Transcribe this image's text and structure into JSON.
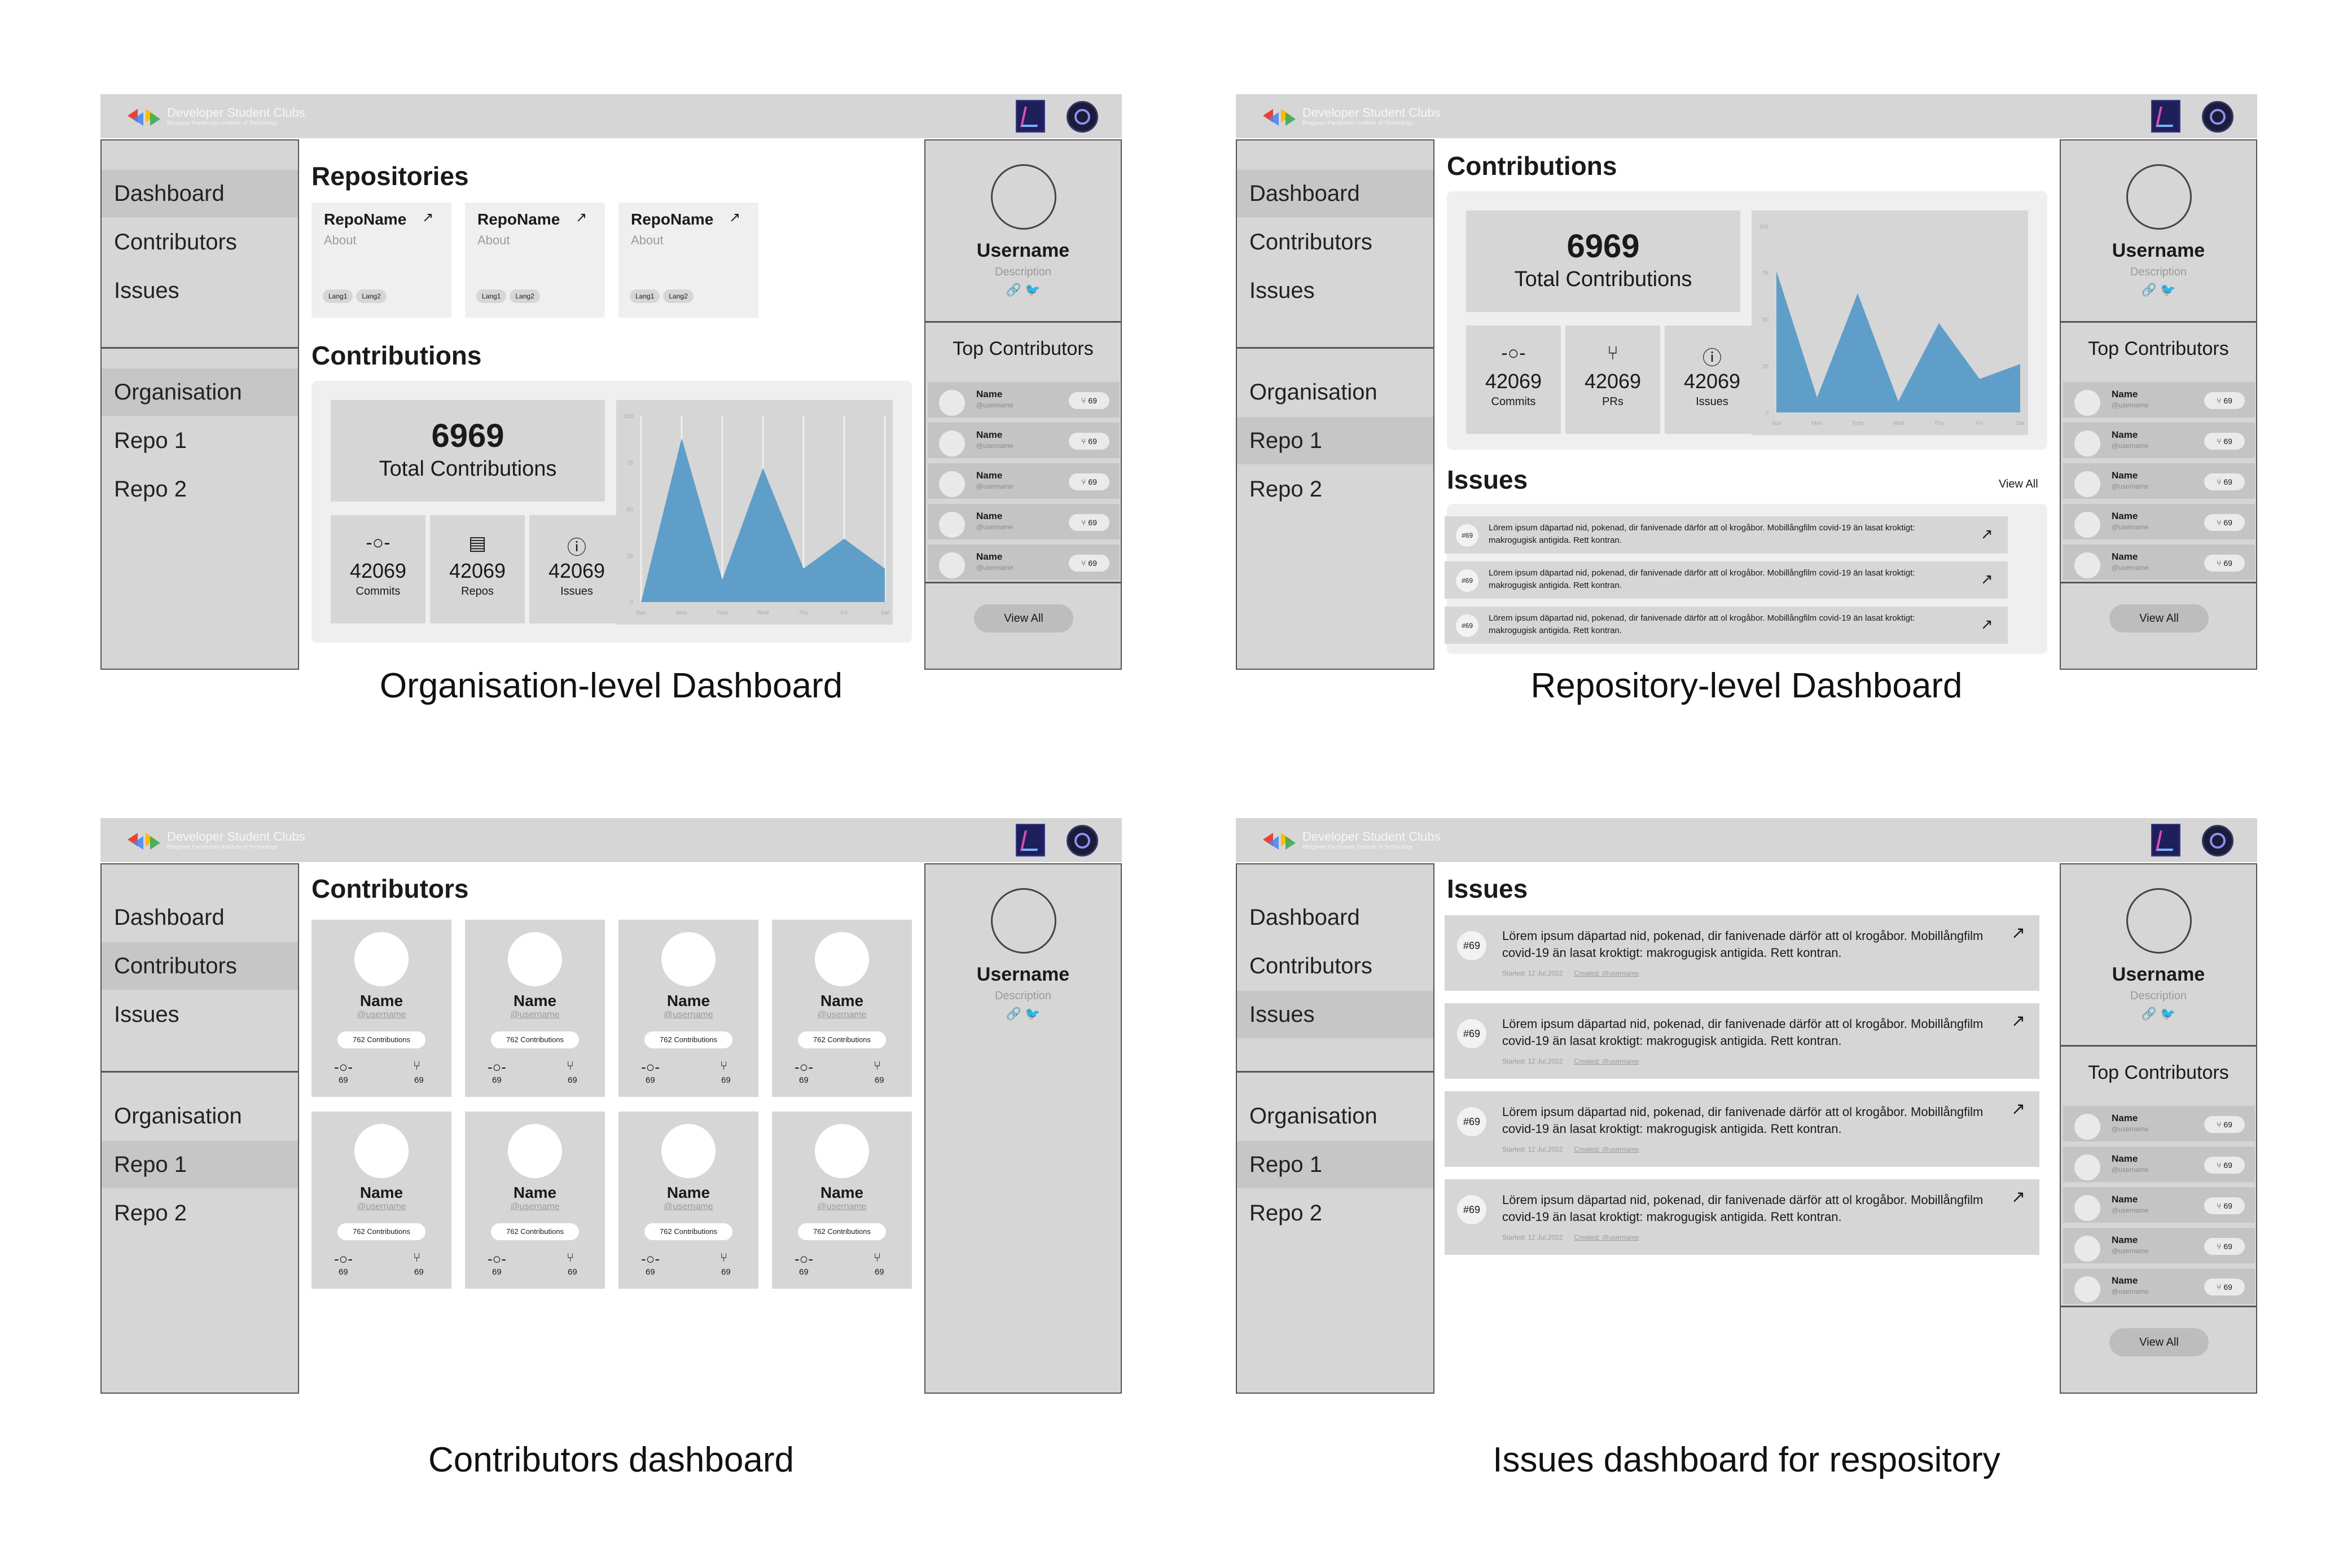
{
  "header": {
    "brand": "Developer Student Clubs",
    "brand_sub": "Bhagwan Parshuram Institute of Technology"
  },
  "nav": {
    "dashboard": "Dashboard",
    "contributors": "Contributors",
    "issues": "Issues",
    "organisation": "Organisation",
    "repo1": "Repo 1",
    "repo2": "Repo 2"
  },
  "profile": {
    "username": "Username",
    "description": "Description",
    "top_contributors_title": "Top Contributors",
    "view_all": "View All"
  },
  "top_contributors": [
    {
      "name": "Name",
      "handle": "@username",
      "count": "69"
    },
    {
      "name": "Name",
      "handle": "@username",
      "count": "69"
    },
    {
      "name": "Name",
      "handle": "@username",
      "count": "69"
    },
    {
      "name": "Name",
      "handle": "@username",
      "count": "69"
    },
    {
      "name": "Name",
      "handle": "@username",
      "count": "69"
    }
  ],
  "org_dashboard": {
    "caption": "Organisation-level Dashboard",
    "repositories_title": "Repositories",
    "repos": [
      {
        "name": "RepoName",
        "about": "About",
        "lang1": "Lang1",
        "lang2": "Lang2"
      },
      {
        "name": "RepoName",
        "about": "About",
        "lang1": "Lang1",
        "lang2": "Lang2"
      },
      {
        "name": "RepoName",
        "about": "About",
        "lang1": "Lang1",
        "lang2": "Lang2"
      }
    ],
    "contributions_title": "Contributions",
    "total": "6969",
    "total_label": "Total Contributions",
    "stats": [
      {
        "value": "42069",
        "label": "Commits"
      },
      {
        "value": "42069",
        "label": "Repos"
      },
      {
        "value": "42069",
        "label": "Issues"
      }
    ]
  },
  "repo_dashboard": {
    "caption": "Repository-level Dashboard",
    "contributions_title": "Contributions",
    "total": "6969",
    "total_label": "Total Contributions",
    "stats": [
      {
        "value": "42069",
        "label": "Commits"
      },
      {
        "value": "42069",
        "label": "PRs"
      },
      {
        "value": "42069",
        "label": "Issues"
      }
    ],
    "issues_title": "Issues",
    "view_all": "View All",
    "issues": [
      {
        "number": "#69",
        "text": "Lörem ipsum däpartad nid, pokenad, dir fanivenade därför att ol krogåbor. Mobillångfilm covid-19 än lasat kroktigt: makrogugisk antigida. Rett kontran."
      },
      {
        "number": "#69",
        "text": "Lörem ipsum däpartad nid, pokenad, dir fanivenade därför att ol krogåbor. Mobillångfilm covid-19 än lasat kroktigt: makrogugisk antigida. Rett kontran."
      },
      {
        "number": "#69",
        "text": "Lörem ipsum däpartad nid, pokenad, dir fanivenade därför att ol krogåbor. Mobillångfilm covid-19 än lasat kroktigt: makrogugisk antigida. Rett kontran."
      }
    ]
  },
  "contributors_dashboard": {
    "caption": "Contributors dashboard",
    "title": "Contributors",
    "cards": [
      {
        "name": "Name",
        "handle": "@username",
        "contributions": "762 Contributions",
        "commits": "69",
        "prs": "69"
      },
      {
        "name": "Name",
        "handle": "@username",
        "contributions": "762 Contributions",
        "commits": "69",
        "prs": "69"
      },
      {
        "name": "Name",
        "handle": "@username",
        "contributions": "762 Contributions",
        "commits": "69",
        "prs": "69"
      },
      {
        "name": "Name",
        "handle": "@username",
        "contributions": "762 Contributions",
        "commits": "69",
        "prs": "69"
      },
      {
        "name": "Name",
        "handle": "@username",
        "contributions": "762 Contributions",
        "commits": "69",
        "prs": "69"
      },
      {
        "name": "Name",
        "handle": "@username",
        "contributions": "762 Contributions",
        "commits": "69",
        "prs": "69"
      },
      {
        "name": "Name",
        "handle": "@username",
        "contributions": "762 Contributions",
        "commits": "69",
        "prs": "69"
      },
      {
        "name": "Name",
        "handle": "@username",
        "contributions": "762 Contributions",
        "commits": "69",
        "prs": "69"
      }
    ]
  },
  "issues_dashboard": {
    "caption": "Issues dashboard for respository",
    "title": "Issues",
    "issues": [
      {
        "number": "#69",
        "text": "Lörem ipsum däpartad nid, pokenad, dir fanivenade därför att ol krogåbor. Mobillångfilm covid-19 än lasat kroktigt: makrogugisk antigida. Rett kontran.",
        "started": "Started: 12 Jul,2022",
        "created": "Created: @username"
      },
      {
        "number": "#69",
        "text": "Lörem ipsum däpartad nid, pokenad, dir fanivenade därför att ol krogåbor. Mobillångfilm covid-19 än lasat kroktigt: makrogugisk antigida. Rett kontran.",
        "started": "Started: 12 Jul,2022",
        "created": "Created: @username"
      },
      {
        "number": "#69",
        "text": "Lörem ipsum däpartad nid, pokenad, dir fanivenade därför att ol krogåbor. Mobillångfilm covid-19 än lasat kroktigt: makrogugisk antigida. Rett kontran.",
        "started": "Started: 12 Jul,2022",
        "created": "Created: @username"
      },
      {
        "number": "#69",
        "text": "Lörem ipsum däpartad nid, pokenad, dir fanivenade därför att ol krogåbor. Mobillångfilm covid-19 än lasat kroktigt: makrogugisk antigida. Rett kontran.",
        "started": "Started: 12 Jul,2022",
        "created": "Created: @username"
      }
    ]
  },
  "colors": {
    "chart_fill": "#5f9ec9",
    "chrome": "#d6d6d6",
    "selected": "#c6c6c6"
  },
  "chart_data": [
    {
      "type": "area",
      "categories": [
        "Sun",
        "Mon",
        "Tues",
        "Wed",
        "Thu",
        "Fri",
        "Sat"
      ],
      "values": [
        0,
        88,
        12,
        72,
        18,
        34,
        18
      ],
      "ylim": [
        0,
        100
      ],
      "yticks": [
        "0",
        "25",
        "50",
        "75",
        "100"
      ],
      "grid": true
    },
    {
      "type": "area",
      "categories": [
        "Sun",
        "Mon",
        "Tues",
        "Wed",
        "Thu",
        "Fri",
        "Sat"
      ],
      "values": [
        76,
        8,
        64,
        6,
        48,
        18,
        26
      ],
      "ylim": [
        0,
        100
      ],
      "yticks": [
        "0",
        "25",
        "50",
        "75",
        "100"
      ],
      "grid": false
    }
  ]
}
